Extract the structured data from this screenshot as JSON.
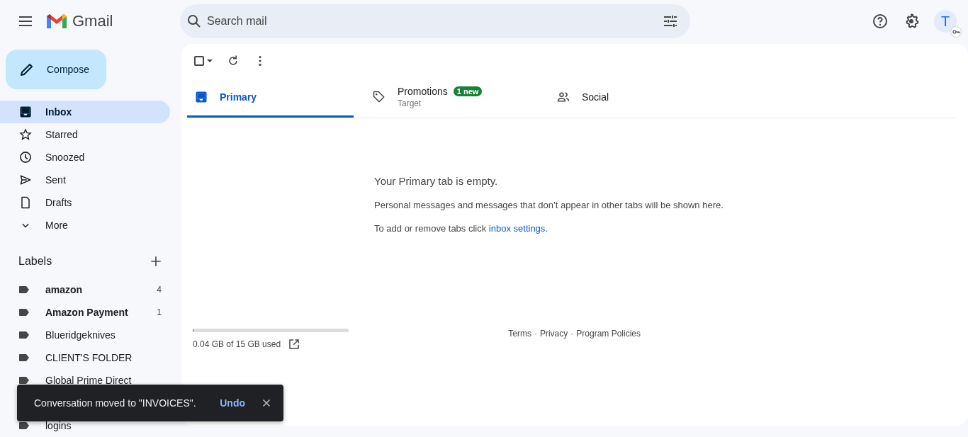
{
  "header": {
    "app_name": "Gmail",
    "search": {
      "placeholder": "Search mail"
    },
    "avatar_letter": "T"
  },
  "compose": "Compose",
  "nav": [
    {
      "label": "Inbox",
      "kind": "inbox",
      "selected": true
    },
    {
      "label": "Starred",
      "kind": "starred",
      "selected": false
    },
    {
      "label": "Snoozed",
      "kind": "snoozed",
      "selected": false
    },
    {
      "label": "Sent",
      "kind": "sent",
      "selected": false
    },
    {
      "label": "Drafts",
      "kind": "drafts",
      "selected": false
    },
    {
      "label": "More",
      "kind": "more",
      "selected": false
    }
  ],
  "labels": {
    "title": "Labels",
    "items": [
      {
        "name": "amazon",
        "count": "4",
        "unread": true
      },
      {
        "name": "Amazon Payment",
        "count": "1",
        "unread": true
      },
      {
        "name": "Blueridgeknives",
        "unread": false
      },
      {
        "name": "CLIENT'S FOLDER",
        "unread": false
      },
      {
        "name": "Global Prime Direct",
        "unread": false
      },
      {
        "name": "logins",
        "unread": false
      }
    ]
  },
  "toolbar": {
    "checked": false
  },
  "tabs": [
    {
      "label": "Primary",
      "kind": "primary",
      "selected": true
    },
    {
      "label": "Promotions",
      "kind": "promotions",
      "selected": false,
      "badge": "1 new",
      "subtitle": "Target"
    },
    {
      "label": "Social",
      "kind": "social",
      "selected": false
    }
  ],
  "empty": {
    "title": "Your Primary tab is empty.",
    "text": "Personal messages and messages that don’t appear in other tabs will be shown here.",
    "settings": {
      "before": "To add or remove tabs click ",
      "link": "inbox settings",
      "after": "."
    }
  },
  "storage": {
    "level": 0.003,
    "text": "0.04 GB of 15 GB used"
  },
  "footer": {
    "links": [
      "Terms",
      "Privacy",
      "Program Policies"
    ],
    "separator": "·"
  },
  "snackbar": {
    "message": "Conversation moved to \"INVOICES\".",
    "action": "Undo"
  }
}
